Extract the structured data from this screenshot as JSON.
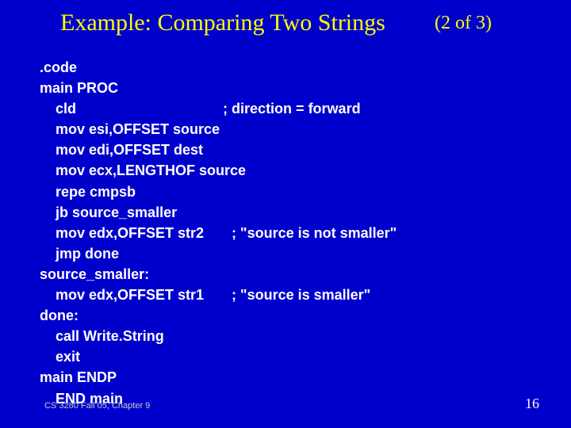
{
  "title": "Example: Comparing Two Strings",
  "subtitle": "(2 of 3)",
  "code": ".code\nmain PROC\n    cld                                     ; direction = forward\n    mov esi,OFFSET source\n    mov edi,OFFSET dest\n    mov ecx,LENGTHOF source\n    repe cmpsb\n    jb source_smaller\n    mov edx,OFFSET str2       ; \"source is not smaller\"\n    jmp done\nsource_smaller:\n    mov edx,OFFSET str1       ; \"source is smaller\"\ndone:\n    call Write.String\n    exit\nmain ENDP\n    END main",
  "footer": "CS 3280 Fall 05, Chapter 9",
  "page": "16"
}
